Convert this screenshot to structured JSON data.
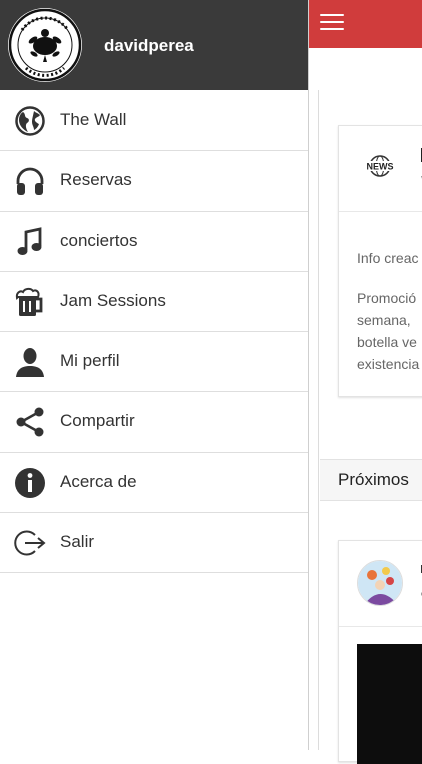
{
  "header": {
    "username": "davidperea"
  },
  "menu": [
    {
      "label": "The Wall",
      "icon": "globe-icon"
    },
    {
      "label": "Reservas",
      "icon": "headphones-icon"
    },
    {
      "label": "conciertos",
      "icon": "music-note-icon"
    },
    {
      "label": "Jam Sessions",
      "icon": "beer-mug-icon"
    },
    {
      "label": "Mi perfil",
      "icon": "person-icon"
    },
    {
      "label": "Compartir",
      "icon": "share-icon"
    },
    {
      "label": "Acerca de",
      "icon": "info-icon"
    },
    {
      "label": "Salir",
      "icon": "logout-icon"
    }
  ],
  "background": {
    "card_news": {
      "icon": "news-icon",
      "badge_text": "NEWS",
      "sub_fragment": "v",
      "line1": "Info creac",
      "line2": "Promoció",
      "line3": "semana, ",
      "line4": "botella ve",
      "line5": "existencia"
    },
    "section_title": "Próximos",
    "card_event": {
      "avatar_icon": "illustration-avatar-icon"
    }
  },
  "colors": {
    "accent": "#d03c3c",
    "drawer_header": "#3a3a3a"
  }
}
